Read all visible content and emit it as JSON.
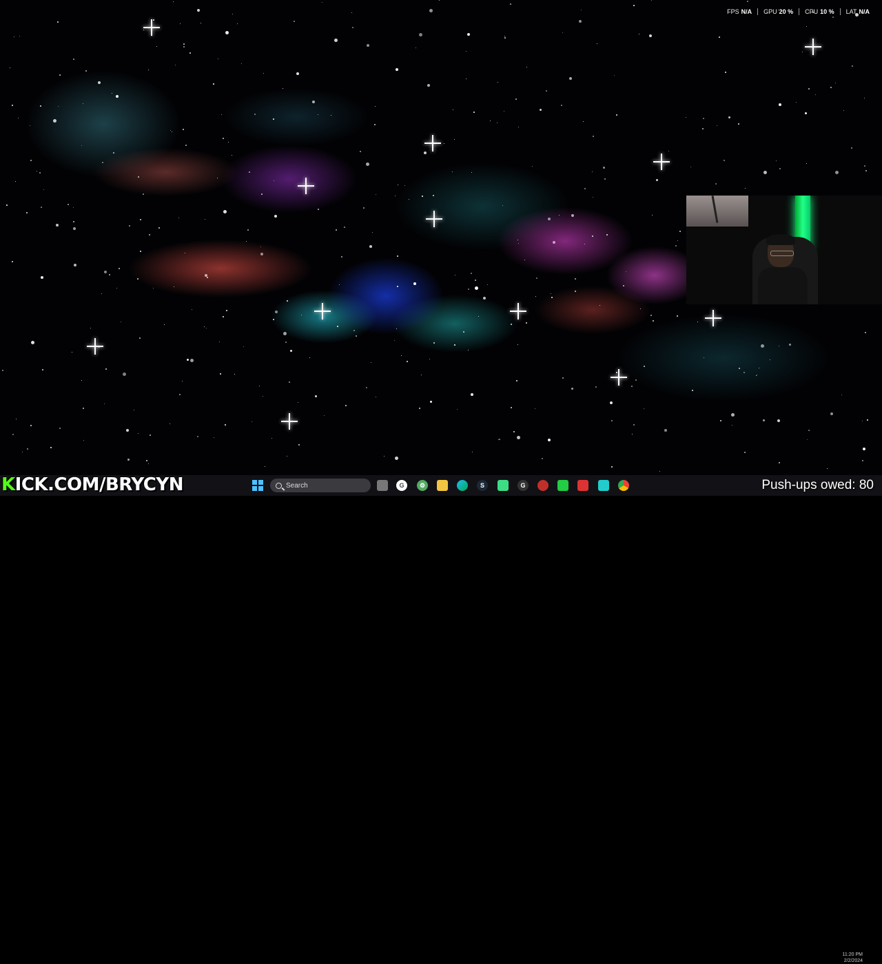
{
  "perf_overlay": {
    "items": [
      {
        "label": "FPS",
        "value": "N/A"
      },
      {
        "label": "GPU",
        "value": "20 %"
      },
      {
        "label": "CPU",
        "value": "10 %"
      },
      {
        "label": "LAT",
        "value": "N/A"
      }
    ]
  },
  "stream_overlay": {
    "kick_k": "K",
    "kick_rest": "ICK.COM/BRYCYN",
    "pushups_text": "Push-ups owed: 80"
  },
  "taskbar": {
    "search_placeholder": "Search",
    "clock_time": "11:20 PM",
    "clock_date": "2/2/2024",
    "icons": [
      "start-icon",
      "task-view-icon",
      "google-icon",
      "settings-icon",
      "file-explorer-icon",
      "edge-icon",
      "steam-icon",
      "android-icon",
      "epic-icon",
      "red-app-icon",
      "green-app-icon",
      "video-app-icon",
      "discord-icon",
      "chrome-icon"
    ]
  },
  "colors": {
    "kick_green": "#53fc18",
    "start_blue": "#4cc2ff"
  }
}
